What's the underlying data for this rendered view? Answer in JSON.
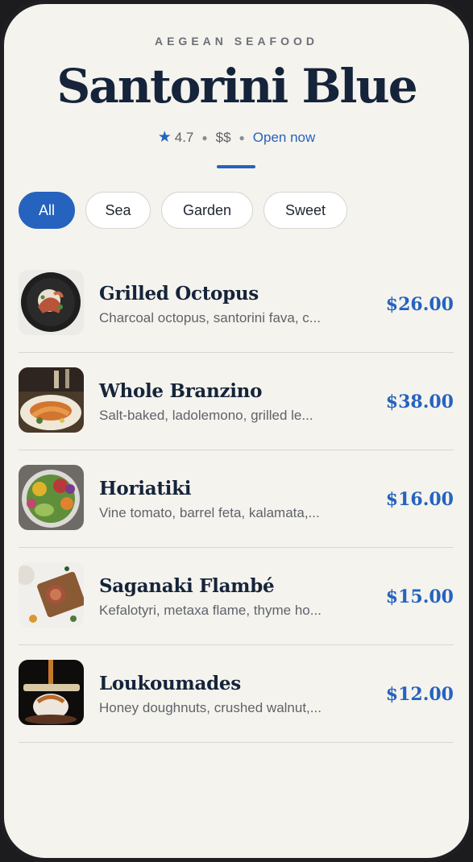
{
  "restaurant": {
    "eyebrow": "AEGEAN SEAFOOD",
    "name": "Santorini Blue",
    "rating": "4.7",
    "price_level": "$$",
    "status": "Open now",
    "star_icon": "star-icon",
    "accent_color": "#2563be"
  },
  "filters": {
    "selected": "All",
    "items": [
      "All",
      "Sea",
      "Garden",
      "Sweet"
    ]
  },
  "menu": [
    {
      "name": "Grilled Octopus",
      "description": "Charcoal octopus, santorini fava, c...",
      "price": "$26.00",
      "image": "octopus-dish-photo"
    },
    {
      "name": "Whole Branzino",
      "description": "Salt-baked, ladolemono, grilled le...",
      "price": "$38.00",
      "image": "branzino-dish-photo"
    },
    {
      "name": "Horiatiki",
      "description": "Vine tomato, barrel feta, kalamata,...",
      "price": "$16.00",
      "image": "salad-dish-photo"
    },
    {
      "name": "Saganaki Flambé",
      "description": "Kefalotyri, metaxa flame, thyme ho...",
      "price": "$15.00",
      "image": "saganaki-dish-photo"
    },
    {
      "name": "Loukoumades",
      "description": "Honey doughnuts, crushed walnut,...",
      "price": "$12.00",
      "image": "loukoumades-dish-photo"
    }
  ]
}
